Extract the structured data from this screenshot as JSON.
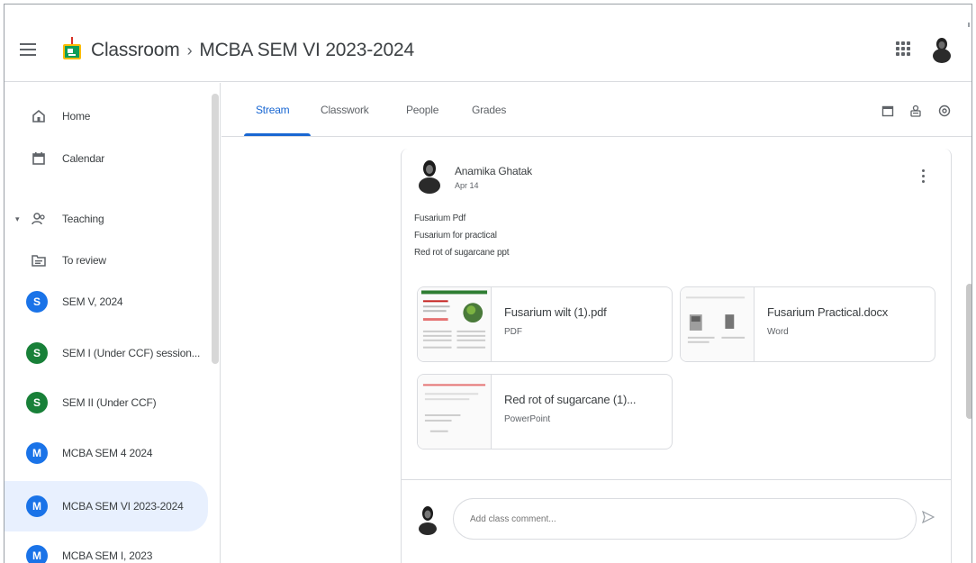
{
  "header": {
    "app_name": "Classroom",
    "separator": "›",
    "class_name": "MCBA SEM VI 2023-2024"
  },
  "sidebar": {
    "home": "Home",
    "calendar": "Calendar",
    "teaching": "Teaching",
    "to_review": "To review",
    "classes": [
      {
        "initial": "S",
        "label": "SEM V, 2024",
        "color": "#1a73e8"
      },
      {
        "initial": "S",
        "label": "SEM I (Under CCF) session...",
        "color": "#188038"
      },
      {
        "initial": "S",
        "label": "SEM II (Under CCF)",
        "color": "#188038"
      },
      {
        "initial": "M",
        "label": "MCBA SEM 4 2024",
        "color": "#1a73e8"
      },
      {
        "initial": "M",
        "label": "MCBA SEM VI 2023-2024",
        "color": "#1a73e8"
      },
      {
        "initial": "M",
        "label": "MCBA SEM I, 2023",
        "color": "#1a73e8"
      }
    ]
  },
  "tabs": {
    "stream": "Stream",
    "classwork": "Classwork",
    "people": "People",
    "grades": "Grades"
  },
  "post": {
    "author": "Anamika Ghatak",
    "date": "Apr 14",
    "lines": [
      "Fusarium Pdf",
      "Fusarium for practical",
      "Red rot of sugarcane ppt"
    ],
    "attachments": [
      {
        "title": "Fusarium wilt (1).pdf",
        "type": "PDF"
      },
      {
        "title": "Fusarium Practical.docx",
        "type": "Word"
      },
      {
        "title": "Red rot of sugarcane (1)...",
        "type": "PowerPoint"
      }
    ]
  },
  "comment": {
    "placeholder": "Add class comment..."
  },
  "colors": {
    "accent": "#1967d2",
    "active_bg": "#e8f0fe",
    "green_class": "#188038",
    "blue_class": "#1a73e8"
  }
}
